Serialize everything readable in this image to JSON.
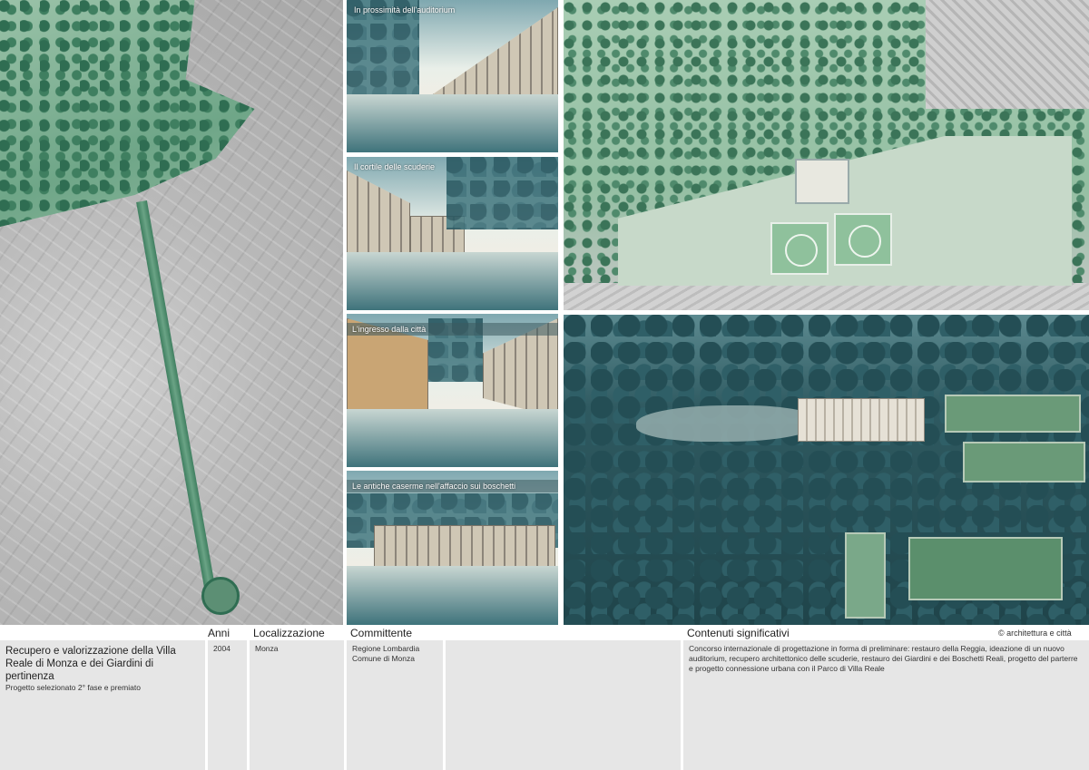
{
  "sketches": [
    {
      "caption": "In prossimità dell'auditorium"
    },
    {
      "caption": "Il cortile delle scuderie"
    },
    {
      "caption": "L'ingresso dalla città"
    },
    {
      "caption": "Le antiche caserme nell'affaccio sui boschetti"
    }
  ],
  "table": {
    "headers": {
      "anni": "Anni",
      "localizzazione": "Localizzazione",
      "committente": "Committente",
      "contenuti": "Contenuti significativi"
    },
    "credit": "© architettura e città",
    "title": "Recupero e valorizzazione della Villa Reale di Monza e dei Giardini di pertinenza",
    "subtitle": "Progetto selezionato 2° fase e premiato",
    "anni": "2004",
    "localizzazione": "Monza",
    "committente": [
      "Regione Lombardia",
      "Comune di Monza"
    ],
    "contenuti": "Concorso internazionale di progettazione in forma di preliminare: restauro della Reggia, ideazione di un nuovo auditorium, recupero architettonico delle scuderie, restauro dei Giardini e dei Boschetti Reali, progetto del parterre e progetto connessione urbana con il Parco di Villa Reale"
  }
}
